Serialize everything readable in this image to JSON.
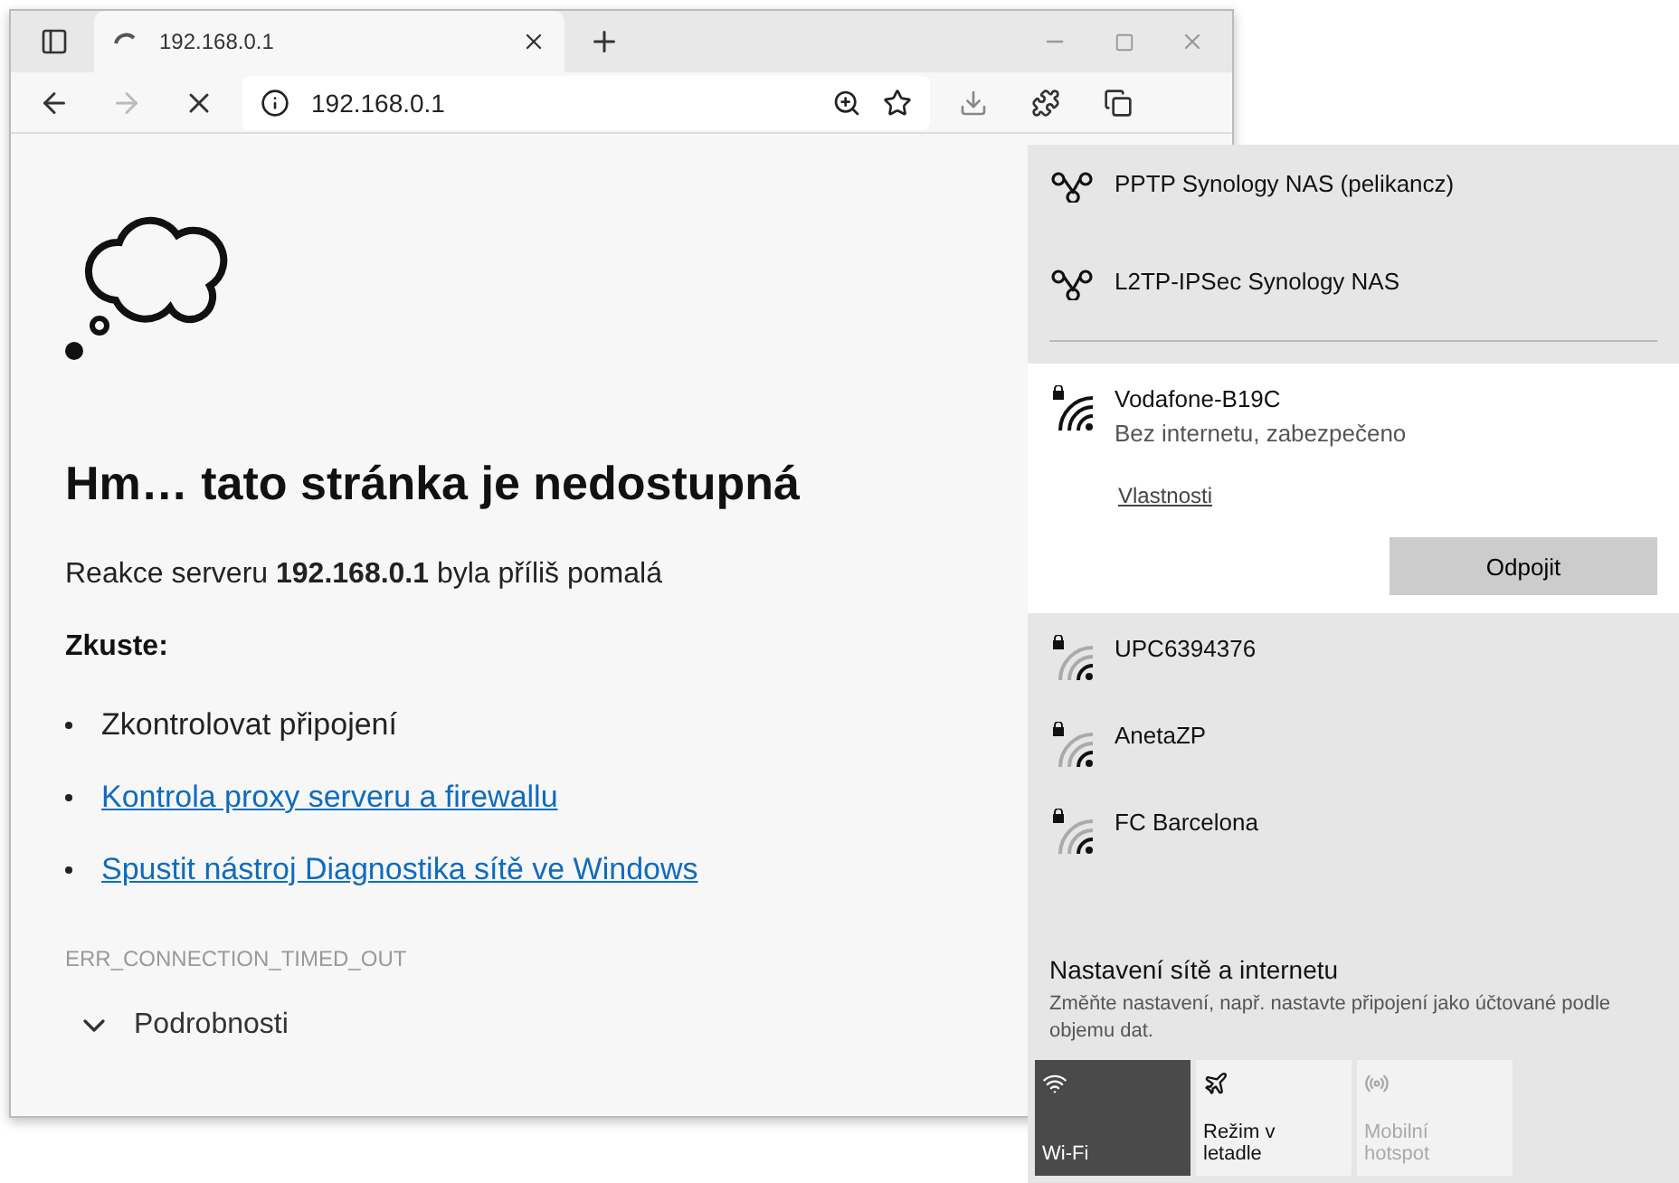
{
  "browser": {
    "tab": {
      "title": "192.168.0.1",
      "loading": true
    },
    "address": "192.168.0.1",
    "error": {
      "heading": "Hm… tato stránka je nedostupná",
      "message": "Reakce serveru **192.168.0.1** byla příliš pomalá",
      "try_label": "Zkuste:",
      "suggestions": [
        {
          "text": "Zkontrolovat připojení",
          "kind": "text"
        },
        {
          "text": "Kontrola proxy serveru a firewallu",
          "kind": "link"
        },
        {
          "text": "Spustit nástroj Diagnostika sítě ve Windows",
          "kind": "link"
        }
      ],
      "code": "ERR_CONNECTION_TIMED_OUT",
      "details": "Podrobnosti"
    }
  },
  "network_flyout": {
    "connections": [
      {
        "kind": "vpn",
        "name": "PPTP Synology NAS (pelikancz)",
        "selected": false
      },
      {
        "kind": "vpn",
        "name": "L2TP-IPSec Synology NAS",
        "selected": false
      },
      {
        "kind": "wifi",
        "name": "Vodafone-B19C",
        "selected": true,
        "status": "Bez internetu, zabezpečeno",
        "properties": "Vlastnosti",
        "action": "Odpojit"
      },
      {
        "kind": "wifi",
        "name": "UPC6394376",
        "selected": false
      },
      {
        "kind": "wifi",
        "name": "AnetaZP",
        "selected": false
      },
      {
        "kind": "wifi",
        "name": "FC Barcelona",
        "selected": false
      }
    ],
    "settings": {
      "title": "Nastavení sítě a internetu",
      "description": "Změňte nastavení, např. nastavte připojení jako účtované podle objemu dat."
    },
    "quick_actions": [
      {
        "kind": "wifi",
        "label": "Wi-Fi",
        "on": true,
        "disabled": false
      },
      {
        "kind": "airplane",
        "label": "Režim v letadle",
        "on": false,
        "disabled": false
      },
      {
        "kind": "hotspot",
        "label": "Mobilní hotspot",
        "on": false,
        "disabled": true
      }
    ]
  }
}
